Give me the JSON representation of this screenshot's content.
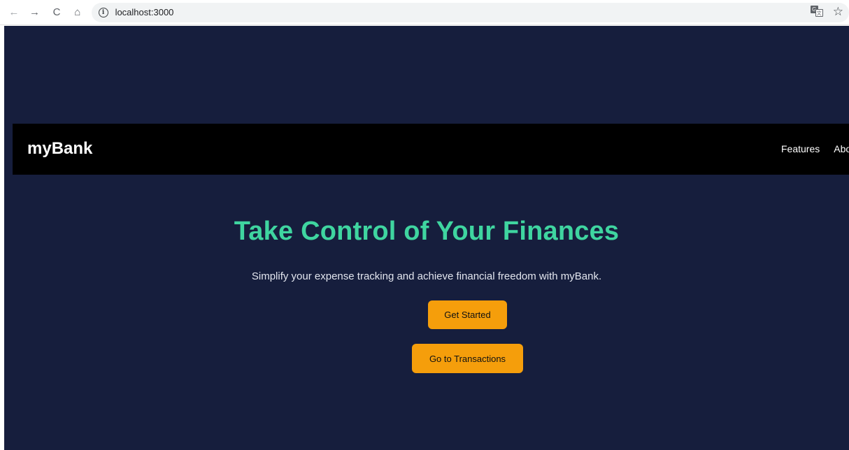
{
  "browser": {
    "back_icon": "←",
    "forward_icon": "→",
    "reload_icon": "C",
    "home_icon": "⌂",
    "info_icon": "i",
    "url": "localhost:3000",
    "translate_a": "G",
    "translate_b": "文",
    "star_icon": "☆"
  },
  "navbar": {
    "brand": "myBank",
    "links": [
      "Features",
      "About"
    ]
  },
  "hero": {
    "title": "Take Control of Your Finances",
    "subtitle": "Simplify your expense tracking and achieve financial freedom with myBank.",
    "primary_button": "Get Started",
    "secondary_button": "Go to Transactions"
  },
  "colors": {
    "background": "#161e3d",
    "navbar": "#000000",
    "accent_title": "#3fd5a0",
    "button": "#f59e0b"
  }
}
